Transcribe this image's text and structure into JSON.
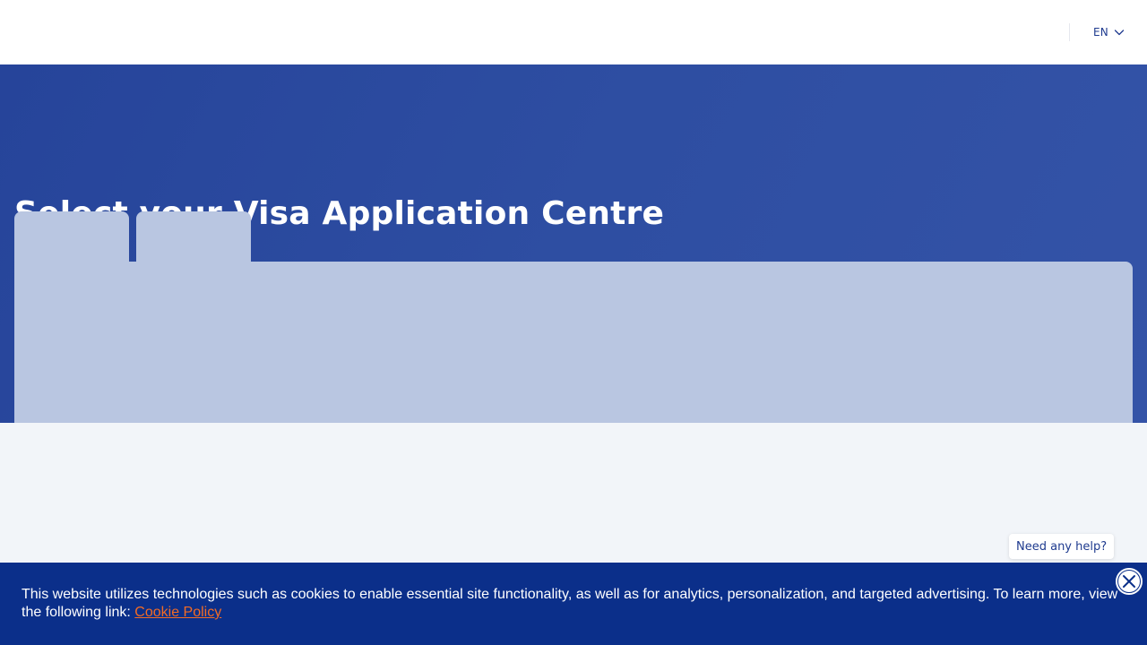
{
  "header": {
    "language": {
      "code": "EN",
      "icon": "chevron-down-icon"
    }
  },
  "hero": {
    "title": "Select your Visa Application Centre"
  },
  "help": {
    "label": "Need any help?"
  },
  "cookie_banner": {
    "text": "This website utilizes technologies such as cookies to enable essential site functionality, as well as for analytics, personalization, and targeted advertising. To learn more, view the following link: ",
    "link_label": "Cookie Policy",
    "close_icon": "close-icon"
  },
  "colors": {
    "header_bg": "#ffffff",
    "hero_bg": "#2e4ea2",
    "panel_bg": "#b9c6e1",
    "page_bg": "#f2f5f9",
    "banner_bg": "#0b2f8a",
    "link": "#f36b24",
    "accent_text": "#1f3b8f"
  }
}
